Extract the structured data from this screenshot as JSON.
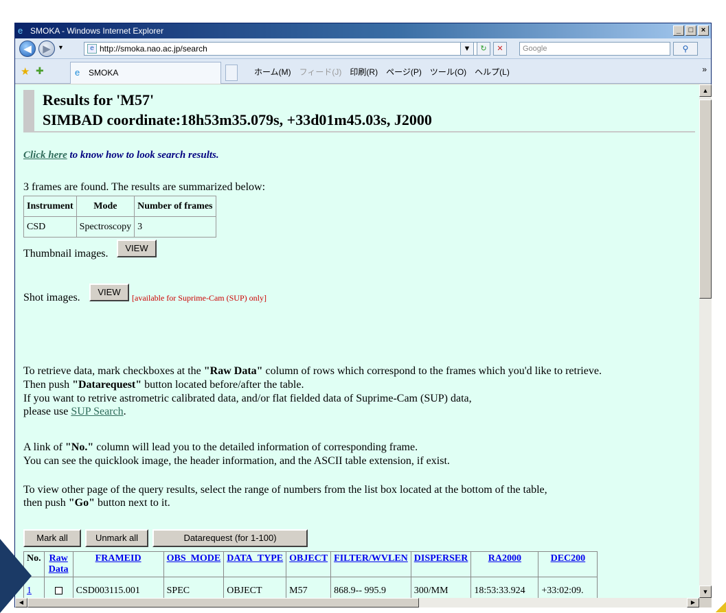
{
  "window": {
    "title": "SMOKA - Windows Internet Explorer",
    "buttons": [
      "_",
      "□",
      "×"
    ]
  },
  "address_bar": {
    "url": "http://smoka.nao.ac.jp/search",
    "search_placeholder": "Google"
  },
  "favorites_bar": {
    "tab_title": "SMOKA",
    "commands": [
      "ホーム(M)",
      "フィード(J)",
      "印刷(R)",
      "ページ(P)",
      "ツール(O)",
      "ヘルプ(L)"
    ]
  },
  "page": {
    "heading_line1": "Results for 'M57'",
    "heading_line2": "SIMBAD coordinate:18h53m35.079s, +33d01m45.03s, J2000",
    "help_link": "Click here",
    "help_text": " to know how to look search results.",
    "found_text": "3 frames are found. The results are summarized below:",
    "summary_table": {
      "headers": [
        "Instrument",
        "Mode",
        "Number of frames"
      ],
      "rows": [
        [
          "CSD",
          "Spectroscopy",
          "3"
        ]
      ]
    },
    "thumbnail_label": "Thumbnail images.",
    "view_label": "VIEW",
    "shot_label": "Shot images.",
    "shot_note": "[available for Suprime-Cam (SUP) only]",
    "para1_line1_pre": "To retrieve data, mark checkboxes at the ",
    "para1_line1_bold": "\"Raw Data\"",
    "para1_line1_post": " column of rows which correspond to the frames which you'd like to retrieve.",
    "para1_line2_pre": "Then push ",
    "para1_line2_bold": "\"Datarequest\"",
    "para1_line2_post": " button located before/after the table.",
    "para1_line3": "If you want to retrive astrometric calibrated data, and/or flat fielded data of Suprime-Cam (SUP) data,",
    "para1_line4_pre": "please use ",
    "para1_line4_link": "SUP Search",
    "para1_line4_post": ".",
    "para2_line1_pre": "A link of ",
    "para2_line1_bold": "\"No.\"",
    "para2_line1_post": " column will lead you to the detailed information of corresponding frame.",
    "para2_line2": "You can see the quicklook image, the header information, and the ASCII table extension, if exist.",
    "para3_line1": "To view other page of the query results, select the range of numbers from the list box located at the bottom of the table,",
    "para3_line2_pre": "then push ",
    "para3_line2_bold": "\"Go\"",
    "para3_line2_post": " button next to it.",
    "mark_all": "Mark all",
    "unmark_all": "Unmark all",
    "datarequest": "Datarequest (for 1-100)",
    "results_table": {
      "headers": [
        "No.",
        "Raw Data",
        "FRAMEID",
        "OBS_MODE",
        "DATA_TYPE",
        "OBJECT",
        "FILTER/WVLEN",
        "DISPERSER",
        "RA2000",
        "DEC200"
      ],
      "rows": [
        [
          "1",
          "",
          "CSD003115.001",
          "SPEC",
          "OBJECT",
          "M57",
          "868.9-- 995.9",
          "300/MM",
          "18:53:33.924",
          "+33:02:09."
        ]
      ]
    }
  }
}
